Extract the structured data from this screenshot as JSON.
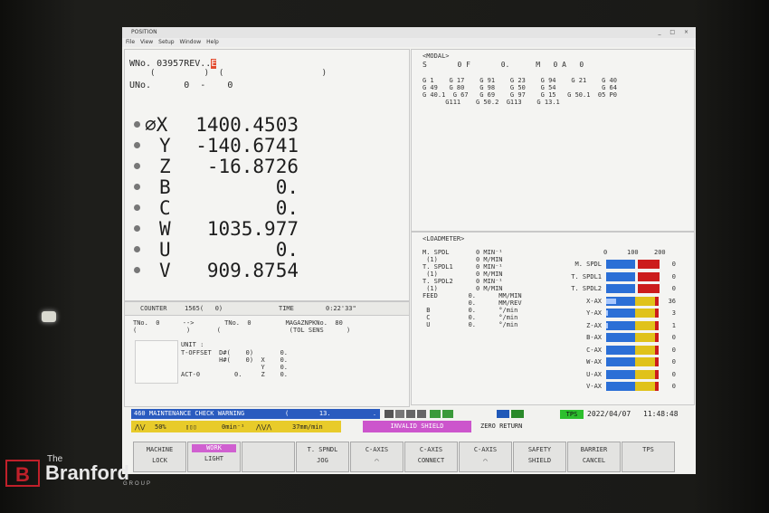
{
  "window": {
    "title": "POSITION",
    "menu": [
      "File",
      "View",
      "Setup",
      "Window",
      "Help"
    ]
  },
  "program": {
    "wno_label": "WNo.",
    "wno_value": "03957REV..",
    "cursor_char": "E",
    "paren_line1": "(          )  (                    )",
    "uno_label": "UNo.",
    "uno_value": "0  -    0"
  },
  "axes": [
    {
      "label": "X",
      "prefix": "∅",
      "value": "1400.4503"
    },
    {
      "label": "Y",
      "prefix": "",
      "value": "-140.6741"
    },
    {
      "label": "Z",
      "prefix": "",
      "value": "-16.8726"
    },
    {
      "label": "B",
      "prefix": "",
      "value": "0."
    },
    {
      "label": "C",
      "prefix": "",
      "value": "0."
    },
    {
      "label": "W",
      "prefix": "",
      "value": "1035.977"
    },
    {
      "label": "U",
      "prefix": "",
      "value": "0."
    },
    {
      "label": "V",
      "prefix": "",
      "value": "909.8754"
    }
  ],
  "counter": {
    "label": "COUNTER",
    "value": "1565(   0)",
    "time_label": "TIME",
    "time_value": "0:22'33\""
  },
  "tool": {
    "line1": "TNo.  0      -->        TNo.  0         MAGAZNPKNo.  80",
    "line2": "(             )       (                  (TOL SENS      )",
    "unit": "UNIT :",
    "toffset": "T-OFFSET  D#(    0)       0.\n          H#(    0)  X    0.\n                     Y    0.\nACT-0         0.     Z    0."
  },
  "modal": {
    "header": "<MODAL>",
    "sfm": "S       0 F       0.      M   0 A   0",
    "gcodes": "G 1    G 17    G 91    G 23    G 94    G 21    G 40\nG 49   G 80    G 98    G 50    G 54            G 64\nG 40.1  G 67   G 69    G 97    G 15   G 50.1  05 P0\n      G111    G 50.2  G113    G 13.1"
  },
  "loadmeter": {
    "header": "<LOADMETER>",
    "left": "M. SPDL       0 MIN⁻¹\n (1)          0 M/MIN\nT. SPDL1      0 MIN⁻¹\n (1)          0 M/MIN\nT. SPDL2      0 MIN⁻¹\n (1)          0 M/MIN\nFEED        0.      MM/MIN\n            0.      MM/REV\n B          0.      °/min\n C          0.      °/min\n U          0.      °/min",
    "scale": [
      "0",
      "100",
      "200"
    ],
    "bars": [
      {
        "name": "M. SPDL",
        "value": "0",
        "kind": "spdl",
        "load": 0
      },
      {
        "name": "T. SPDL1",
        "value": "0",
        "kind": "spdl",
        "load": 0
      },
      {
        "name": "T. SPDL2",
        "value": "0",
        "kind": "spdl",
        "load": 0
      },
      {
        "name": "X-AX",
        "value": "36",
        "kind": "ax",
        "load": 36
      },
      {
        "name": "Y-AX",
        "value": "3",
        "kind": "ax",
        "load": 3
      },
      {
        "name": "Z-AX",
        "value": "1",
        "kind": "ax",
        "load": 1
      },
      {
        "name": "B-AX",
        "value": "0",
        "kind": "ax",
        "load": 0
      },
      {
        "name": "C-AX",
        "value": "0",
        "kind": "ax",
        "load": 0
      },
      {
        "name": "W-AX",
        "value": "0",
        "kind": "ax",
        "load": 0
      },
      {
        "name": "U-AX",
        "value": "0",
        "kind": "ax",
        "load": 0
      },
      {
        "name": "V-AX",
        "value": "0",
        "kind": "ax",
        "load": 0
      }
    ]
  },
  "status": {
    "alarm": "460 MAINTENANCE CHECK WARNING",
    "alarm_paren": "(        13.           .          )",
    "override_pct": "50%",
    "spindle_rate": "0min⁻¹",
    "feed_rate": "37mm/min",
    "tps": "TPS",
    "date": "2022/04/07",
    "time": "11:48:48",
    "invalid_shield": "INVALID SHIELD",
    "zero_return": "ZERO RETURN"
  },
  "softkeys": [
    {
      "line1": "MACHINE",
      "line2": "LOCK",
      "active": false
    },
    {
      "line1": "WORK",
      "line2": "LIGHT",
      "active": true
    },
    {
      "line1": "",
      "line2": "",
      "active": false
    },
    {
      "line1": "T. SPNDL",
      "line2": "JOG",
      "active": false
    },
    {
      "line1": "C-AXIS",
      "line2": "⌒",
      "active": false
    },
    {
      "line1": "C-AXIS",
      "line2": "CONNECT",
      "active": false
    },
    {
      "line1": "C-AXIS",
      "line2": "⌒",
      "active": false
    },
    {
      "line1": "SAFETY",
      "line2": "SHIELD",
      "active": false
    },
    {
      "line1": "BARRIER",
      "line2": "CANCEL",
      "active": false
    },
    {
      "line1": "TPS",
      "line2": "",
      "active": false
    }
  ],
  "watermark": {
    "the": "The",
    "name": "Branford",
    "group": "GROUP",
    "mark": "B"
  },
  "colors": {
    "bar_blue": "#2b6fd6",
    "bar_yellow": "#e0c21a",
    "bar_red": "#cc1c1c",
    "alarm_bg": "#2a5bbf",
    "invalid_bg": "#cc55cc"
  }
}
